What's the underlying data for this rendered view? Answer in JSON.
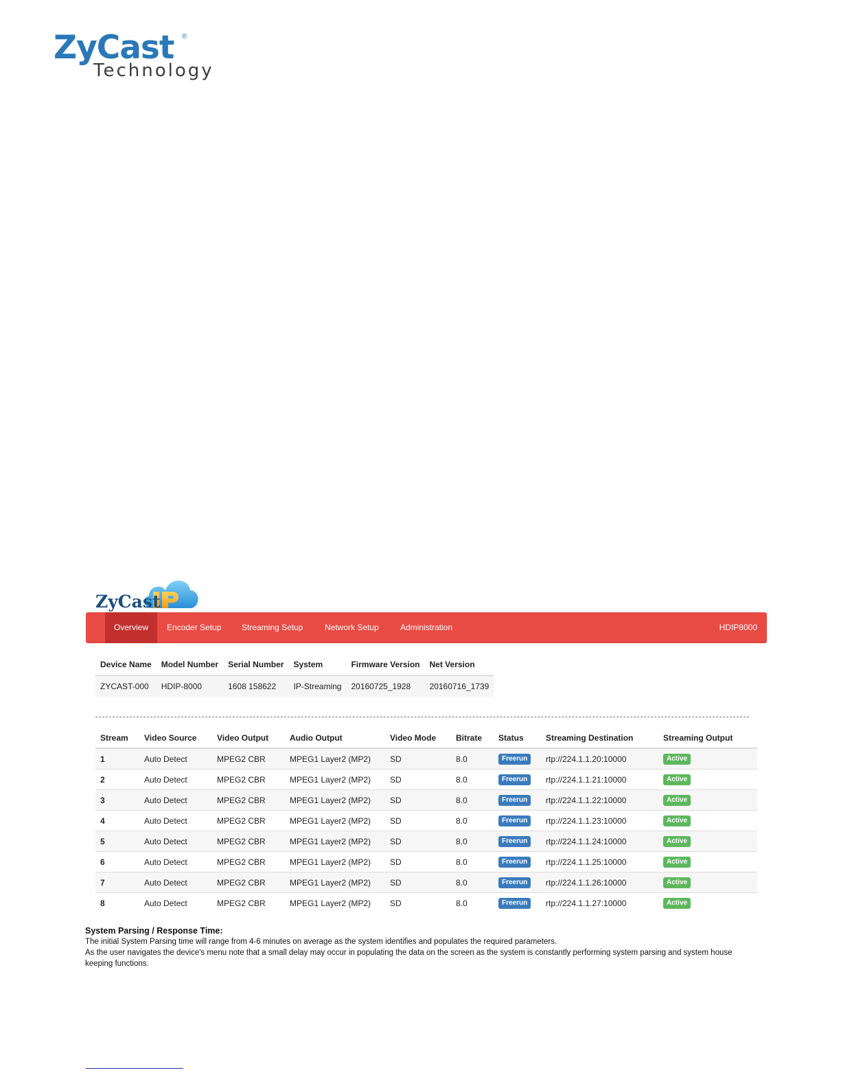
{
  "brand": {
    "name": "ZyCast",
    "registered": "®",
    "subtitle": "Technology"
  },
  "app": {
    "logo_text": "ZyCast",
    "logo_badge": "IP",
    "nav": {
      "items": [
        {
          "label": "Overview",
          "active": true
        },
        {
          "label": "Encoder Setup",
          "active": false
        },
        {
          "label": "Streaming Setup",
          "active": false
        },
        {
          "label": "Network Setup",
          "active": false
        },
        {
          "label": "Administration",
          "active": false
        }
      ],
      "device_label": "HDIP8000"
    },
    "device_table": {
      "headers": [
        "Device Name",
        "Model Number",
        "Serial Number",
        "System",
        "Firmware Version",
        "Net Version"
      ],
      "row": [
        "ZYCAST-000",
        "HDIP-8000",
        "1608 158622",
        "IP-Streaming",
        "20160725_1928",
        "20160716_1739"
      ]
    },
    "stream_table": {
      "headers": [
        "Stream",
        "Video Source",
        "Video Output",
        "Audio Output",
        "Video Mode",
        "Bitrate",
        "Status",
        "Streaming Destination",
        "Streaming Output"
      ],
      "rows": [
        {
          "stream": "1",
          "source": "Auto Detect",
          "video_out": "MPEG2 CBR",
          "audio_out": "MPEG1 Layer2 (MP2)",
          "mode": "SD",
          "bitrate": "8.0",
          "status": "Freerun",
          "dest": "rtp://224.1.1.20:10000",
          "output": "Active"
        },
        {
          "stream": "2",
          "source": "Auto Detect",
          "video_out": "MPEG2 CBR",
          "audio_out": "MPEG1 Layer2 (MP2)",
          "mode": "SD",
          "bitrate": "8.0",
          "status": "Freerun",
          "dest": "rtp://224.1.1.21:10000",
          "output": "Active"
        },
        {
          "stream": "3",
          "source": "Auto Detect",
          "video_out": "MPEG2 CBR",
          "audio_out": "MPEG1 Layer2 (MP2)",
          "mode": "SD",
          "bitrate": "8.0",
          "status": "Freerun",
          "dest": "rtp://224.1.1.22:10000",
          "output": "Active"
        },
        {
          "stream": "4",
          "source": "Auto Detect",
          "video_out": "MPEG2 CBR",
          "audio_out": "MPEG1 Layer2 (MP2)",
          "mode": "SD",
          "bitrate": "8.0",
          "status": "Freerun",
          "dest": "rtp://224.1.1.23:10000",
          "output": "Active"
        },
        {
          "stream": "5",
          "source": "Auto Detect",
          "video_out": "MPEG2 CBR",
          "audio_out": "MPEG1 Layer2 (MP2)",
          "mode": "SD",
          "bitrate": "8.0",
          "status": "Freerun",
          "dest": "rtp://224.1.1.24:10000",
          "output": "Active"
        },
        {
          "stream": "6",
          "source": "Auto Detect",
          "video_out": "MPEG2 CBR",
          "audio_out": "MPEG1 Layer2 (MP2)",
          "mode": "SD",
          "bitrate": "8.0",
          "status": "Freerun",
          "dest": "rtp://224.1.1.25:10000",
          "output": "Active"
        },
        {
          "stream": "7",
          "source": "Auto Detect",
          "video_out": "MPEG2 CBR",
          "audio_out": "MPEG1 Layer2 (MP2)",
          "mode": "SD",
          "bitrate": "8.0",
          "status": "Freerun",
          "dest": "rtp://224.1.1.26:10000",
          "output": "Active"
        },
        {
          "stream": "8",
          "source": "Auto Detect",
          "video_out": "MPEG2 CBR",
          "audio_out": "MPEG1 Layer2 (MP2)",
          "mode": "SD",
          "bitrate": "8.0",
          "status": "Freerun",
          "dest": "rtp://224.1.1.27:10000",
          "output": "Active"
        }
      ]
    }
  },
  "notes": {
    "heading": "System Parsing / Response Time:",
    "lines": [
      "The initial System Parsing time will range from 4-6 minutes on average as the system identifies and populates the required parameters.",
      "As the user navigates the device's menu note that a small delay may occur in populating the data on the screen as the system is constantly performing system parsing and system house keeping functions."
    ]
  },
  "colors": {
    "navbar": "#e84a44",
    "navbar_active": "#c1302c",
    "brand_blue": "#2a78b8",
    "status_badge": "#3a7bbd",
    "output_badge": "#5cb85c"
  }
}
